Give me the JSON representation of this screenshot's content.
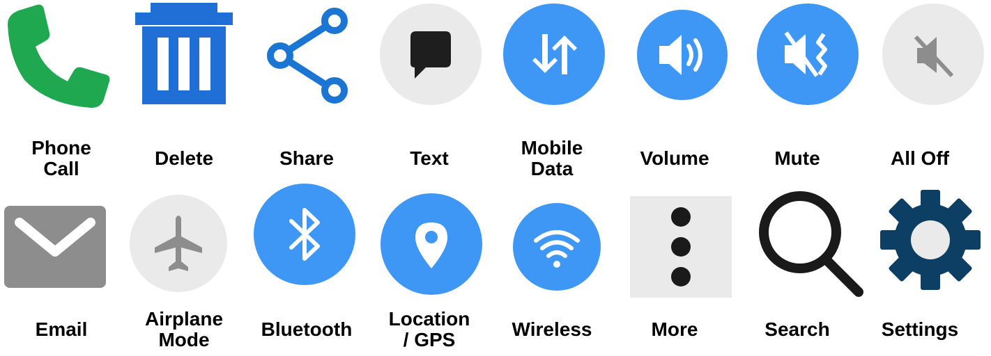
{
  "colors": {
    "phone_green": "#1fa84f",
    "delete_blue": "#1f6fd6",
    "share_blue": "#1a76d2",
    "accent_blue": "#3f97f5",
    "light_gray": "#eaeaea",
    "mid_gray": "#8d8d8d",
    "dark_navy": "#0d3e63",
    "black": "#1a1a1a"
  },
  "icons": [
    {
      "icon": "phone-icon",
      "label": "Phone\nCall"
    },
    {
      "icon": "trash-icon",
      "label": "Delete"
    },
    {
      "icon": "share-icon",
      "label": "Share"
    },
    {
      "icon": "chat-bubble-icon",
      "label": "Text"
    },
    {
      "icon": "data-arrows-icon",
      "label": "Mobile\nData"
    },
    {
      "icon": "speaker-icon",
      "label": "Volume"
    },
    {
      "icon": "speaker-vibrate-mute-icon",
      "label": "Mute"
    },
    {
      "icon": "speaker-muted-icon",
      "label": "All Off"
    },
    {
      "icon": "envelope-icon",
      "label": "Email"
    },
    {
      "icon": "airplane-icon",
      "label": "Airplane\nMode"
    },
    {
      "icon": "bluetooth-icon",
      "label": "Bluetooth"
    },
    {
      "icon": "location-pin-icon",
      "label": "Location\n/ GPS"
    },
    {
      "icon": "wifi-icon",
      "label": "Wireless"
    },
    {
      "icon": "more-dots-icon",
      "label": "More"
    },
    {
      "icon": "search-icon",
      "label": "Search"
    },
    {
      "icon": "gear-icon",
      "label": "Settings"
    }
  ]
}
